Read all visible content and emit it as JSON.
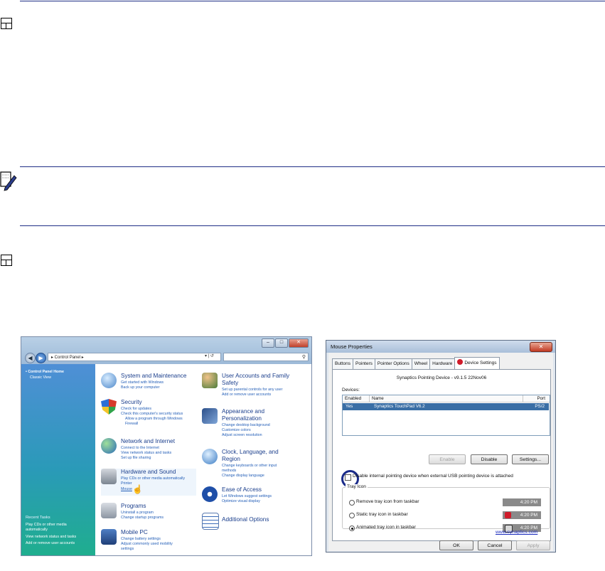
{
  "control_panel": {
    "address": "▸ Control Panel ▸",
    "sidebar": {
      "home": "• Control Panel Home",
      "classic": "Classic View",
      "recent_title": "Recent Tasks",
      "recent": [
        "Play CDs or other media",
        "automatically",
        "View network status and tasks",
        "Add or remove user accounts"
      ]
    },
    "categories": [
      {
        "title": "System and Maintenance",
        "links": [
          "Get started with Windows",
          "Back up your computer"
        ]
      },
      {
        "title": "Security",
        "links": [
          "Check for updates",
          "Check this computer's security status",
          "Allow a program through Windows",
          "Firewall"
        ]
      },
      {
        "title": "Network and Internet",
        "links": [
          "Connect to the Internet",
          "View network status and tasks",
          "Set up file sharing"
        ]
      },
      {
        "title": "Hardware and Sound",
        "links": [
          "Play CDs or other media automatically",
          "Printer",
          "Mouse"
        ]
      },
      {
        "title": "Programs",
        "links": [
          "Uninstall a program",
          "Change startup programs"
        ]
      },
      {
        "title": "Mobile PC",
        "links": [
          "Change battery settings",
          "Adjust commonly used mobility",
          "settings"
        ]
      },
      {
        "title": "User Accounts and Family",
        "title2": "Safety",
        "links": [
          "Set up parental controls for any user",
          "Add or remove user accounts"
        ]
      },
      {
        "title": "Appearance and",
        "title2": "Personalization",
        "links": [
          "Change desktop background",
          "Customize colors",
          "Adjust screen resolution"
        ]
      },
      {
        "title": "Clock, Language, and",
        "title2": "Region",
        "links": [
          "Change keyboards or other input",
          "methods",
          "Change display language"
        ]
      },
      {
        "title": "Ease of Access",
        "links": [
          "Let Windows suggest settings",
          "Optimize visual display"
        ]
      },
      {
        "title": "Additional Options",
        "links": []
      }
    ]
  },
  "mouse_properties": {
    "title": "Mouse Properties",
    "tabs": [
      "Buttons",
      "Pointers",
      "Pointer Options",
      "Wheel",
      "Hardware",
      "Device Settings"
    ],
    "device_line": "Synaptics Pointing Device - v9.1.5 22Nov06",
    "devices_label": "Devices:",
    "columns": [
      "Enabled",
      "Name",
      "Port"
    ],
    "row": {
      "enabled": "Yes",
      "name": "Synaptics TouchPad V6.2",
      "port": "PS/2"
    },
    "buttons": {
      "enable": "Enable",
      "disable": "Disable",
      "settings": "Settings..."
    },
    "checkbox_label": "Disable internal pointing device when external USB pointing device is attached",
    "tray_group": "Tray Icon",
    "tray_options": [
      "Remove tray icon from taskbar",
      "Static tray icon in taskbar",
      "Animated tray icon in taskbar"
    ],
    "time": "4:20 PM",
    "link": "www.synaptics.com",
    "footer": {
      "ok": "OK",
      "cancel": "Cancel",
      "apply": "Apply"
    }
  },
  "colors": {
    "rule": "#1f2f86",
    "selection": "#3a6ea5",
    "highlight_circle": "#1a2b8a"
  }
}
